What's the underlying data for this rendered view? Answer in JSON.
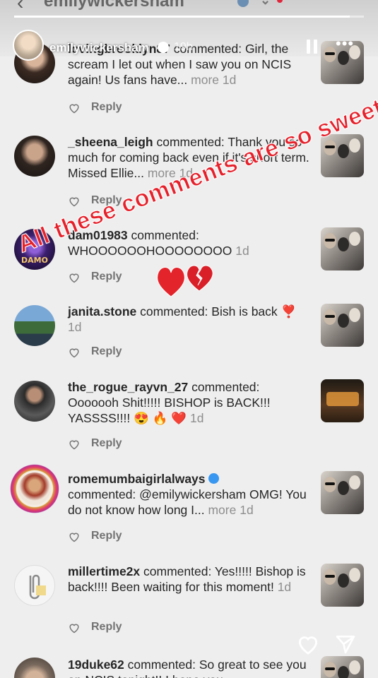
{
  "story": {
    "header_title": "emilywickersham",
    "username": "emilywickersham",
    "time": "19h",
    "progress": 0.96
  },
  "overlay": {
    "text": "All these comments are so sweet!",
    "hearts": "heart-and-broken-heart-emoji"
  },
  "labels": {
    "reply": "Reply",
    "commented": "commented:",
    "more": "more"
  },
  "comments": [
    {
      "user": "lovingbrooklyn87",
      "text": "Girl, the scream I let out when I saw you on NCIS again! Us fans have...",
      "more": "more",
      "time": "1d"
    },
    {
      "user": "_sheena_leigh",
      "text": "Thank you so much for coming back even if it's short term.  Missed Ellie...",
      "more": "more",
      "time": "1d"
    },
    {
      "user": "dam01983",
      "text": "WHOOOOOOHOOOOOOOO",
      "time": "1d"
    },
    {
      "user": "janita.stone",
      "text": "Bish is back ❣️",
      "time": "1d"
    },
    {
      "user": "the_rogue_rayvn_27",
      "text": "Ooooooh Shit!!!!! BISHOP is BACK!!! YASSSS!!!! 😍 🔥 ❤️",
      "time": "1d"
    },
    {
      "user": "romemumbaigirlalways",
      "text": "@emilywickersham OMG! You do not know how long I...",
      "more": "more",
      "time": "1d",
      "verified": true
    },
    {
      "user": "millertime2x",
      "text": "Yes!!!!! Bishop is back!!!! Been waiting for this moment!",
      "time": "1d"
    },
    {
      "user": "19duke62",
      "text": "So great to see you on NCIS tonight!! I hope you"
    }
  ],
  "icons": [
    "chevron-left-icon",
    "verified-badge-icon",
    "pause-icon",
    "more-icon",
    "heart-outline-icon",
    "send-icon"
  ]
}
